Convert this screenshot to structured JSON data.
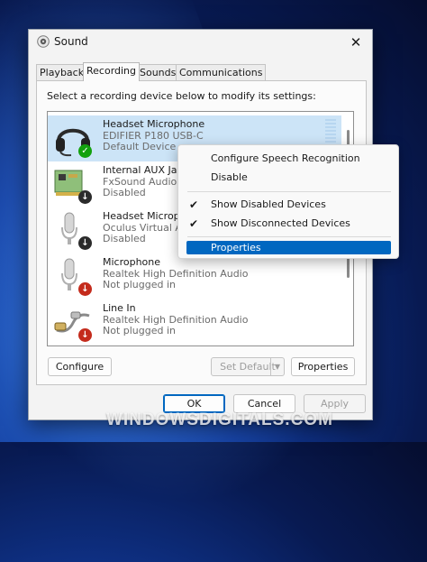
{
  "window": {
    "title": "Sound",
    "icon": "speaker-icon",
    "close": "✕"
  },
  "tabs": [
    "Playback",
    "Recording",
    "Sounds",
    "Communications"
  ],
  "active_tab": "Recording",
  "instruction": "Select a recording device below to modify its settings:",
  "devices": [
    {
      "name": "Headset Microphone",
      "line2": "EDIFIER P180 USB-C",
      "line3": "Default Device",
      "icon": "headset-icon",
      "badge": "✓",
      "status_color": "#13a10e",
      "selected": true
    },
    {
      "name": "Internal AUX Jack",
      "line2": "FxSound Audio E",
      "line3": "Disabled",
      "icon": "sound-card-icon",
      "badge": "↓",
      "status_color": "#2b2b2b",
      "selected": false
    },
    {
      "name": "Headset Microphone",
      "line2": "Oculus Virtual Au",
      "line3": "Disabled",
      "icon": "microphone-icon",
      "badge": "↓",
      "status_color": "#2b2b2b",
      "selected": false
    },
    {
      "name": "Microphone",
      "line2": "Realtek High Definition Audio",
      "line3": "Not plugged in",
      "icon": "microphone-icon",
      "badge": "↓",
      "status_color": "#c42b1c",
      "selected": false
    },
    {
      "name": "Line In",
      "line2": "Realtek High Definition Audio",
      "line3": "Not plugged in",
      "icon": "audio-cable-icon",
      "badge": "↓",
      "status_color": "#c42b1c",
      "selected": false
    }
  ],
  "context_menu": {
    "items": [
      {
        "label": "Configure Speech Recognition",
        "checked": false
      },
      {
        "label": "Disable",
        "checked": false
      },
      {
        "label": "Show Disabled Devices",
        "checked": true
      },
      {
        "label": "Show Disconnected Devices",
        "checked": true
      },
      {
        "label": "Properties",
        "checked": false,
        "highlighted": true
      }
    ],
    "check_glyph": "✔"
  },
  "buttons": {
    "configure": "Configure",
    "set_default": "Set Default",
    "properties": "Properties",
    "ok": "OK",
    "cancel": "Cancel",
    "apply": "Apply"
  },
  "watermark": "WINDOWSDIGITALS.COM",
  "colors": {
    "accent": "#0067c0",
    "selection": "#cce4f7"
  }
}
